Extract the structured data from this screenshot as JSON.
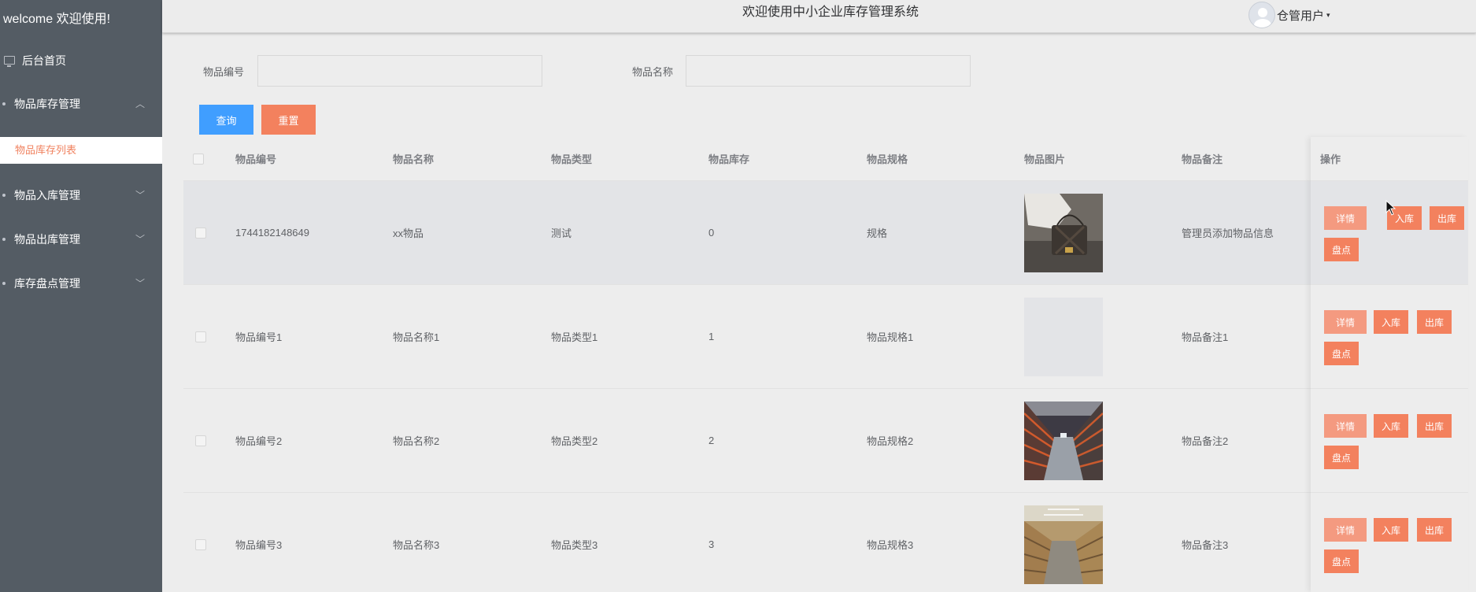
{
  "sidebar": {
    "welcome": "welcome 欢迎使用!",
    "home": "后台首页",
    "menus": [
      {
        "label": "物品库存管理",
        "expanded": true,
        "children": [
          "物品库存列表"
        ]
      },
      {
        "label": "物品入库管理",
        "expanded": false
      },
      {
        "label": "物品出库管理",
        "expanded": false
      },
      {
        "label": "库存盘点管理",
        "expanded": false
      }
    ]
  },
  "header": {
    "title": "欢迎使用中小企业库存管理系统",
    "user": "仓管用户",
    "caret": "▾"
  },
  "search": {
    "code_label": "物品编号",
    "code_value": "",
    "name_label": "物品名称",
    "name_value": "",
    "query_button": "查询",
    "reset_button": "重置"
  },
  "table": {
    "headers": [
      "物品编号",
      "物品名称",
      "物品类型",
      "物品库存",
      "物品规格",
      "物品图片",
      "物品备注",
      "操作"
    ],
    "rows": [
      {
        "code": "1744182148649",
        "name": "xx物品",
        "type": "测试",
        "stock": "0",
        "spec": "规格",
        "image": "handbag-photo",
        "remark": "管理员添加物品信息"
      },
      {
        "code": "物品编号1",
        "name": "物品名称1",
        "type": "物品类型1",
        "stock": "1",
        "spec": "物品规格1",
        "image": "empty",
        "remark": "物品备注1"
      },
      {
        "code": "物品编号2",
        "name": "物品名称2",
        "type": "物品类型2",
        "stock": "2",
        "spec": "物品规格2",
        "image": "warehouse-shelves-photo",
        "remark": "物品备注2"
      },
      {
        "code": "物品编号3",
        "name": "物品名称3",
        "type": "物品类型3",
        "stock": "3",
        "spec": "物品规格3",
        "image": "warehouse-boxes-photo",
        "remark": "物品备注3"
      }
    ],
    "actions": {
      "detail": "详情",
      "in": "入库",
      "out": "出库",
      "check": "盘点"
    }
  },
  "colors": {
    "sidebar_bg": "#545c64",
    "accent": "#f3815e",
    "primary": "#409eff",
    "page_bg": "#ededed"
  }
}
